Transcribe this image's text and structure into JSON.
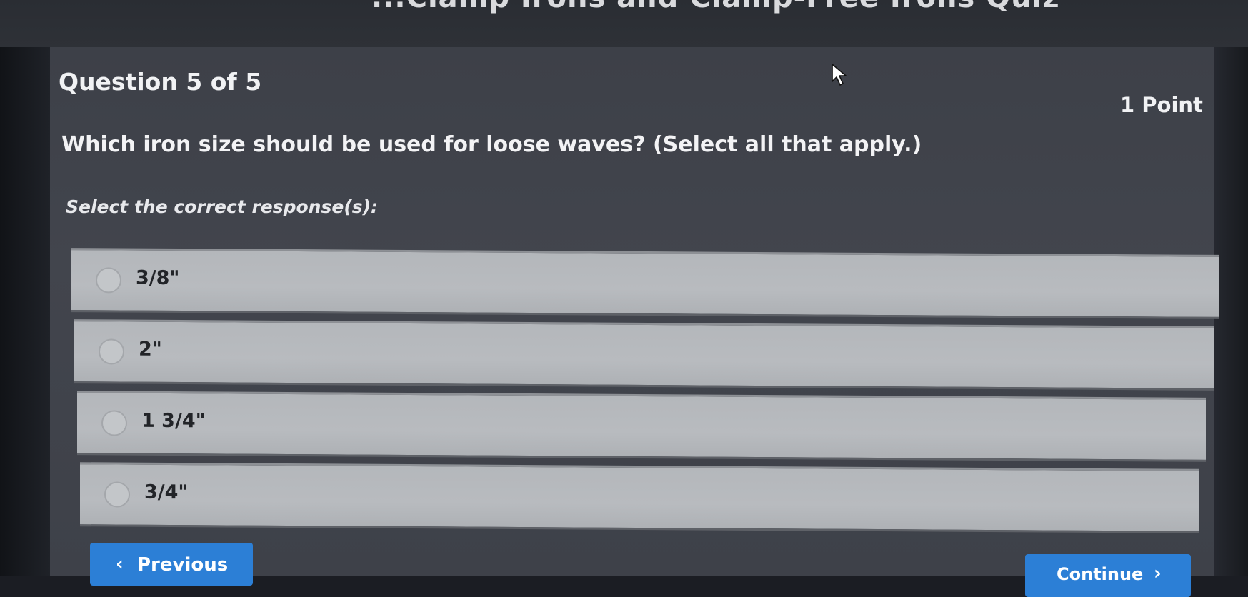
{
  "window": {
    "title": "...Clamp Irons and Clamp-Free Irons Quiz"
  },
  "question": {
    "number_text": "Question 5 of 5",
    "points_text": "1 Point",
    "prompt": "Which iron size should be used for loose waves? (Select all that apply.)",
    "instruction": "Select the correct response(s):"
  },
  "options": [
    {
      "label": "3/8\"",
      "selected": false
    },
    {
      "label": "2\"",
      "selected": false
    },
    {
      "label": "1 3/4\"",
      "selected": false
    },
    {
      "label": "3/4\"",
      "selected": false
    }
  ],
  "navigation": {
    "previous_label": "Previous",
    "continue_label": "Continue"
  },
  "colors": {
    "accent": "#2c7fd6",
    "background": "#3e4149",
    "option_bg": "#b6b9bd"
  }
}
